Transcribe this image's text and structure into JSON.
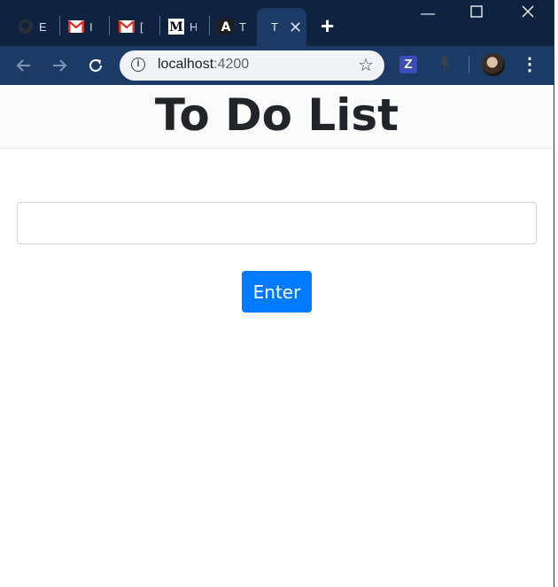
{
  "browser": {
    "tabs": [
      {
        "title": "E",
        "icon": "github-icon"
      },
      {
        "title": "I",
        "icon": "gmail-icon"
      },
      {
        "title": "[",
        "icon": "gmail-icon"
      },
      {
        "title": "H",
        "icon": "medium-icon"
      },
      {
        "title": "T",
        "icon": "a-logo-icon"
      },
      {
        "title": "T",
        "icon": "",
        "active": true
      }
    ],
    "new_tab_glyph": "+",
    "window_controls": {
      "minimize": "—",
      "maximize": "☐",
      "close": "✕"
    },
    "url_host": "localhost",
    "url_port": ":4200",
    "extension_z_label": "Z",
    "colors": {
      "tabstrip": "#0f2341",
      "toolbar": "#1c3a66",
      "omnibox": "#f1f3f4"
    }
  },
  "page": {
    "title": "To Do List",
    "input_value": "",
    "enter_label": "Enter",
    "colors": {
      "primary": "#007bff",
      "text": "#212529"
    }
  }
}
